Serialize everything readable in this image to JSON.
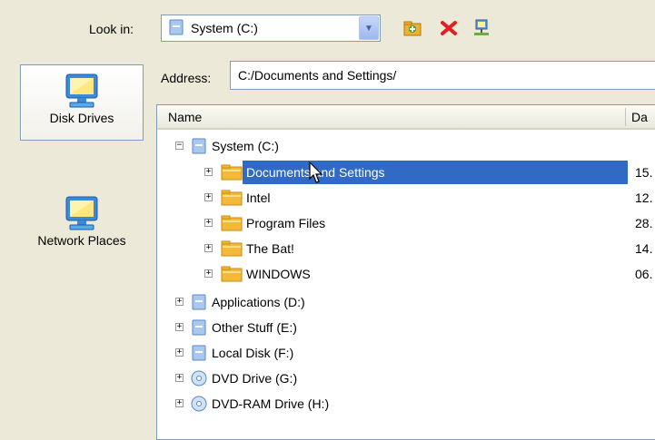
{
  "toolbar": {
    "lookin_label": "Look in:",
    "lookin_value": "System (C:)",
    "icons": [
      "new-folder-icon",
      "delete-icon",
      "network-connect-icon"
    ]
  },
  "address": {
    "label": "Address:",
    "value": "C:/Documents and Settings/"
  },
  "places": [
    {
      "label": "Disk Drives",
      "icon": "computer-icon",
      "selected": true
    },
    {
      "label": "Network Places",
      "icon": "network-computer-icon",
      "selected": false
    }
  ],
  "columns": {
    "name": "Name",
    "date": "Da"
  },
  "tree": {
    "root": {
      "label": "System (C:)",
      "expanded": true
    },
    "children": [
      {
        "label": "Documents and Settings",
        "date": "15.",
        "selected": true
      },
      {
        "label": "Intel",
        "date": "12."
      },
      {
        "label": "Program Files",
        "date": "28."
      },
      {
        "label": "The Bat!",
        "date": "14."
      },
      {
        "label": "WINDOWS",
        "date": "06."
      }
    ],
    "drives": [
      {
        "label": "Applications (D:)",
        "icon": "drive-icon"
      },
      {
        "label": "Other Stuff (E:)",
        "icon": "drive-icon"
      },
      {
        "label": "Local Disk (F:)",
        "icon": "drive-icon"
      },
      {
        "label": "DVD Drive (G:)",
        "icon": "dvd-icon"
      },
      {
        "label": "DVD-RAM Drive (H:)",
        "icon": "dvd-icon"
      }
    ]
  },
  "colors": {
    "selection": "#316ac5",
    "background": "#ece9d8",
    "folder": "#f5b93a",
    "border": "#7f9db9"
  }
}
